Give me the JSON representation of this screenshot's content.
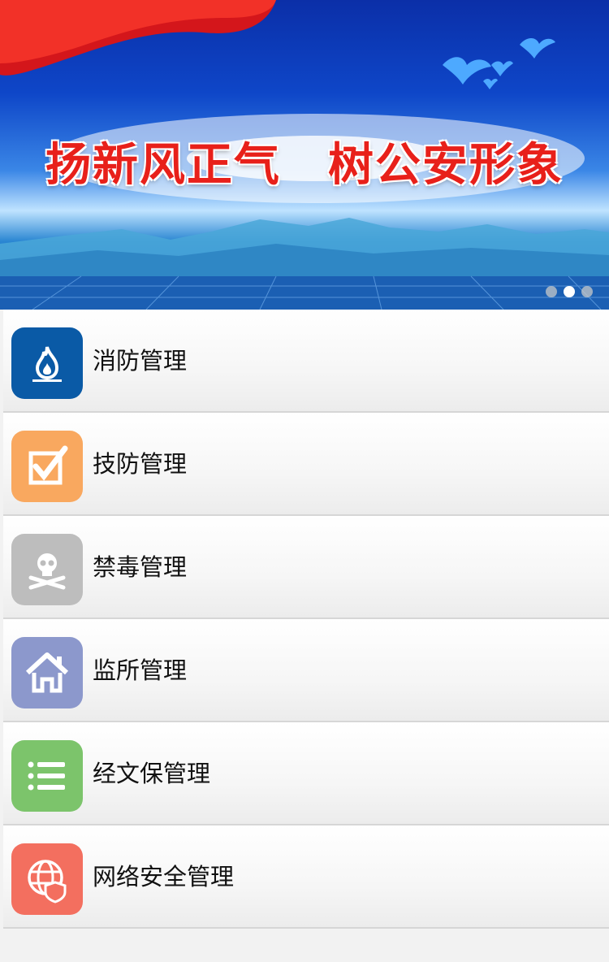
{
  "banner": {
    "slogan": "扬新风正气　树公安形象",
    "carousel_count": 3,
    "carousel_active": 2
  },
  "menu": {
    "items": [
      {
        "label": "消防管理",
        "icon": "flame-icon",
        "color": "#0a5aa6"
      },
      {
        "label": "技防管理",
        "icon": "checkbox-icon",
        "color": "#f9a85f"
      },
      {
        "label": "禁毒管理",
        "icon": "skull-crossbones-icon",
        "color": "#bdbdbd"
      },
      {
        "label": "监所管理",
        "icon": "house-icon",
        "color": "#8c98cc"
      },
      {
        "label": "经文保管理",
        "icon": "list-icon",
        "color": "#7cc46b"
      },
      {
        "label": "网络安全管理",
        "icon": "globe-shield-icon",
        "color": "#f36f5f"
      }
    ]
  }
}
